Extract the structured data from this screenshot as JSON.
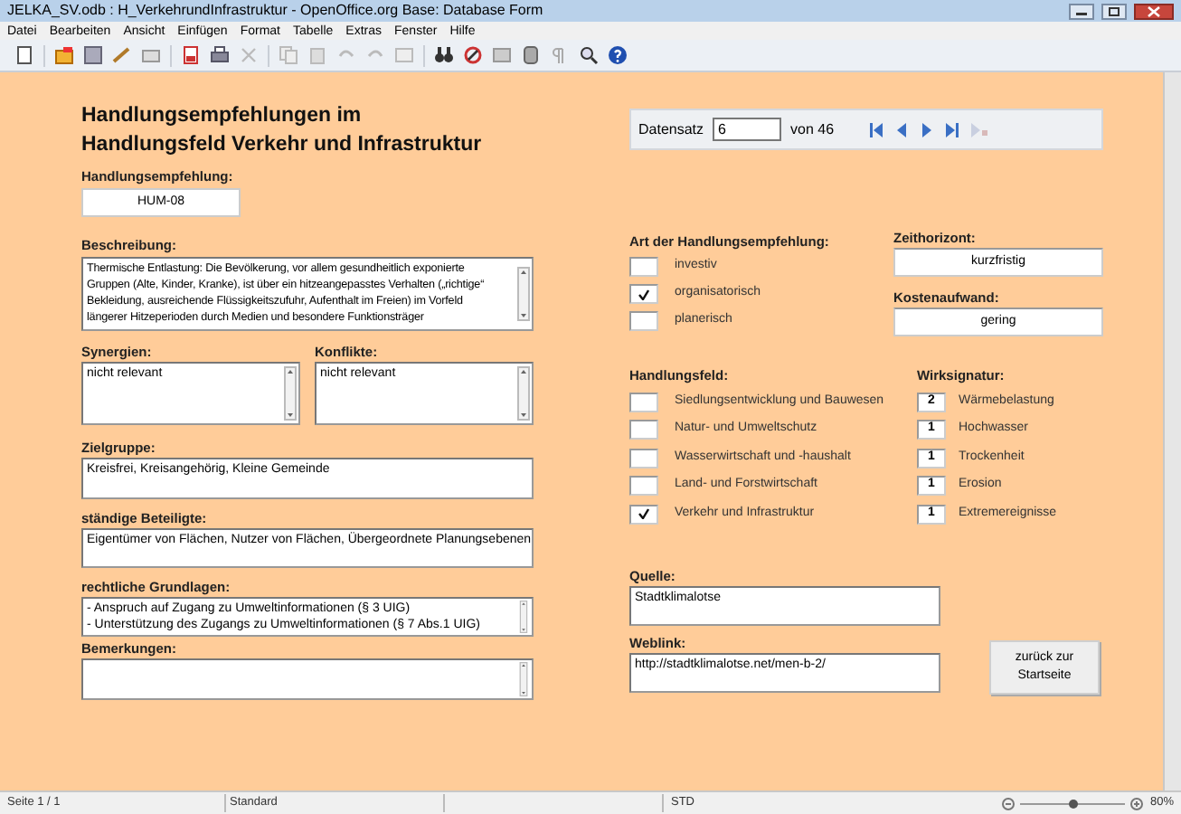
{
  "window": {
    "title": "JELKA_SV.odb : H_VerkehrundInfrastruktur - OpenOffice.org Base: Database Form"
  },
  "menu": [
    "Datei",
    "Bearbeiten",
    "Ansicht",
    "Einfügen",
    "Format",
    "Tabelle",
    "Extras",
    "Fenster",
    "Hilfe"
  ],
  "form": {
    "title_lines": [
      "Handlungsempfehlungen im",
      "Handlungsfeld Verkehr und Infrastruktur"
    ],
    "recommendation": {
      "label": "Handlungsempfehlung:",
      "value": "HUM-08"
    },
    "description": {
      "label": "Beschreibung:",
      "lines": [
        "Thermische Entlastung: Die Bevölkerung, vor allem gesundheitlich exponierte",
        "Gruppen (Alte, Kinder, Kranke), ist über ein hitzeangepasstes Verhalten („richtige“",
        "Bekleidung, ausreichende Flüssigkeitszufuhr, Aufenthalt im Freien) im Vorfeld",
        "längerer Hitzeperioden durch Medien und besondere Funktionsträger"
      ]
    },
    "synergies": {
      "label": "Synergien:",
      "value": "nicht relevant"
    },
    "conflicts": {
      "label": "Konflikte:",
      "value": "nicht relevant"
    },
    "target_group": {
      "label": "Zielgruppe:",
      "value": "Kreisfrei, Kreisangehörig, Kleine Gemeinde"
    },
    "stakeholders": {
      "label": "ständige Beteiligte:",
      "value": "Eigentümer von Flächen, Nutzer von Flächen, Übergeordnete Planungsebenen"
    },
    "legal_basis": {
      "label": "rechtliche Grundlagen:",
      "lines": [
        "- Anspruch auf Zugang zu Umweltinformationen (§ 3 UIG)",
        "- Unterstützung des Zugangs zu Umweltinformationen (§ 7 Abs.1 UIG)"
      ]
    },
    "remarks": {
      "label": "Bemerkungen:"
    },
    "navigator": {
      "label": "Datensatz",
      "value": "6",
      "count": "von 46"
    },
    "type": {
      "label": "Art der Handlungsempfehlung:",
      "options": [
        {
          "label": "investiv",
          "checked": false
        },
        {
          "label": "organisatorisch",
          "checked": true
        },
        {
          "label": "planerisch",
          "checked": false
        }
      ]
    },
    "time_horizon": {
      "label": "Zeithorizont:",
      "value": "kurzfristig"
    },
    "cost": {
      "label": "Kostenaufwand:",
      "value": "gering"
    },
    "field_of_action": {
      "label": "Handlungsfeld:",
      "options": [
        {
          "label": "Siedlungsentwicklung und Bauwesen",
          "checked": false
        },
        {
          "label": "Natur- und Umweltschutz",
          "checked": false
        },
        {
          "label": "Wasserwirtschaft und -haushalt",
          "checked": false
        },
        {
          "label": "Land- und Forstwirtschaft",
          "checked": false
        },
        {
          "label": "Verkehr und Infrastruktur",
          "checked": true
        }
      ]
    },
    "impact": {
      "label": "Wirksignatur:",
      "items": [
        {
          "value": "2",
          "label": "Wärmebelastung"
        },
        {
          "value": "1",
          "label": "Hochwasser"
        },
        {
          "value": "1",
          "label": "Trockenheit"
        },
        {
          "value": "1",
          "label": "Erosion"
        },
        {
          "value": "1",
          "label": "Extremereignisse"
        }
      ]
    },
    "source": {
      "label": "Quelle:",
      "value": "Stadtklimalotse"
    },
    "weblink": {
      "label": "Weblink:",
      "value": "http://stadtklimalotse.net/men-b-2/"
    },
    "back_button": "zurück zur Startseite"
  },
  "status_bar": {
    "page": "Seite 1 / 1",
    "style": "Standard",
    "mode": "STD",
    "zoom": {
      "level": 0.5,
      "reading": "80%"
    }
  }
}
